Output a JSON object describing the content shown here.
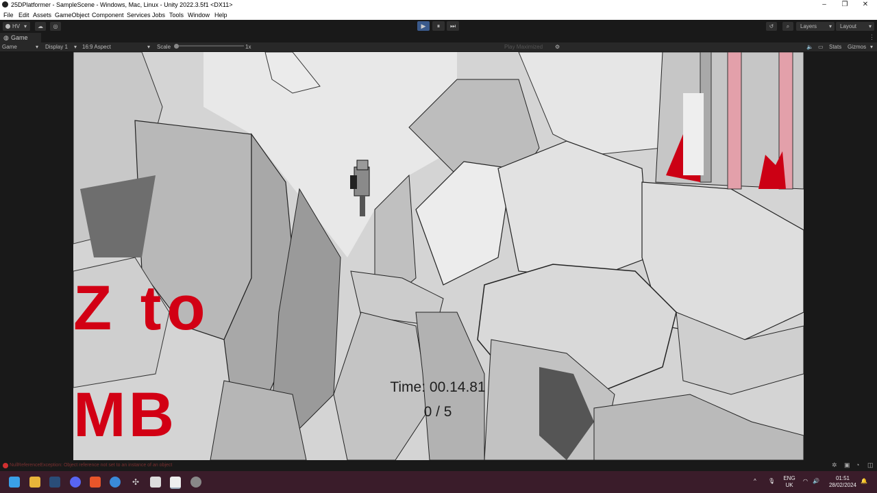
{
  "window": {
    "title": "25DPlatformer - SampleScene - Windows, Mac, Linux - Unity 2022.3.5f1 <DX11>",
    "minimize": "–",
    "maximize": "❐",
    "close": "✕"
  },
  "menu": [
    "File",
    "Edit",
    "Assets",
    "GameObject",
    "Component",
    "Services",
    "Jobs",
    "Tools",
    "Window",
    "Help"
  ],
  "toolbar": {
    "account": "HV",
    "layers": "Layers",
    "layout": "Layout",
    "play_icon": "▶",
    "pause_icon": "⏸",
    "step_icon": "⏭"
  },
  "tab": {
    "label": "Game"
  },
  "gamebar": {
    "mode": "Game",
    "display": "Display 1",
    "aspect": "16:9 Aspect",
    "scale_label": "Scale",
    "scale_value": "1x",
    "play_mode": "Play Maximized",
    "stats": "Stats",
    "gizmos": "Gizmos"
  },
  "hud": {
    "timer": "Time: 00.14.81",
    "counter": "0 / 5",
    "sign_line1": "Z to",
    "sign_line2": "MB"
  },
  "status": {
    "error_message": "NullReferenceException: Object reference not set to an instance of an object"
  },
  "tray": {
    "lang1": "ENG",
    "lang2": "UK",
    "time": "01:51",
    "date": "28/02/2024"
  },
  "colors": {
    "accent": "#d20014",
    "play_active": "#3a5a8c",
    "taskbar": "#3a1c2a"
  }
}
